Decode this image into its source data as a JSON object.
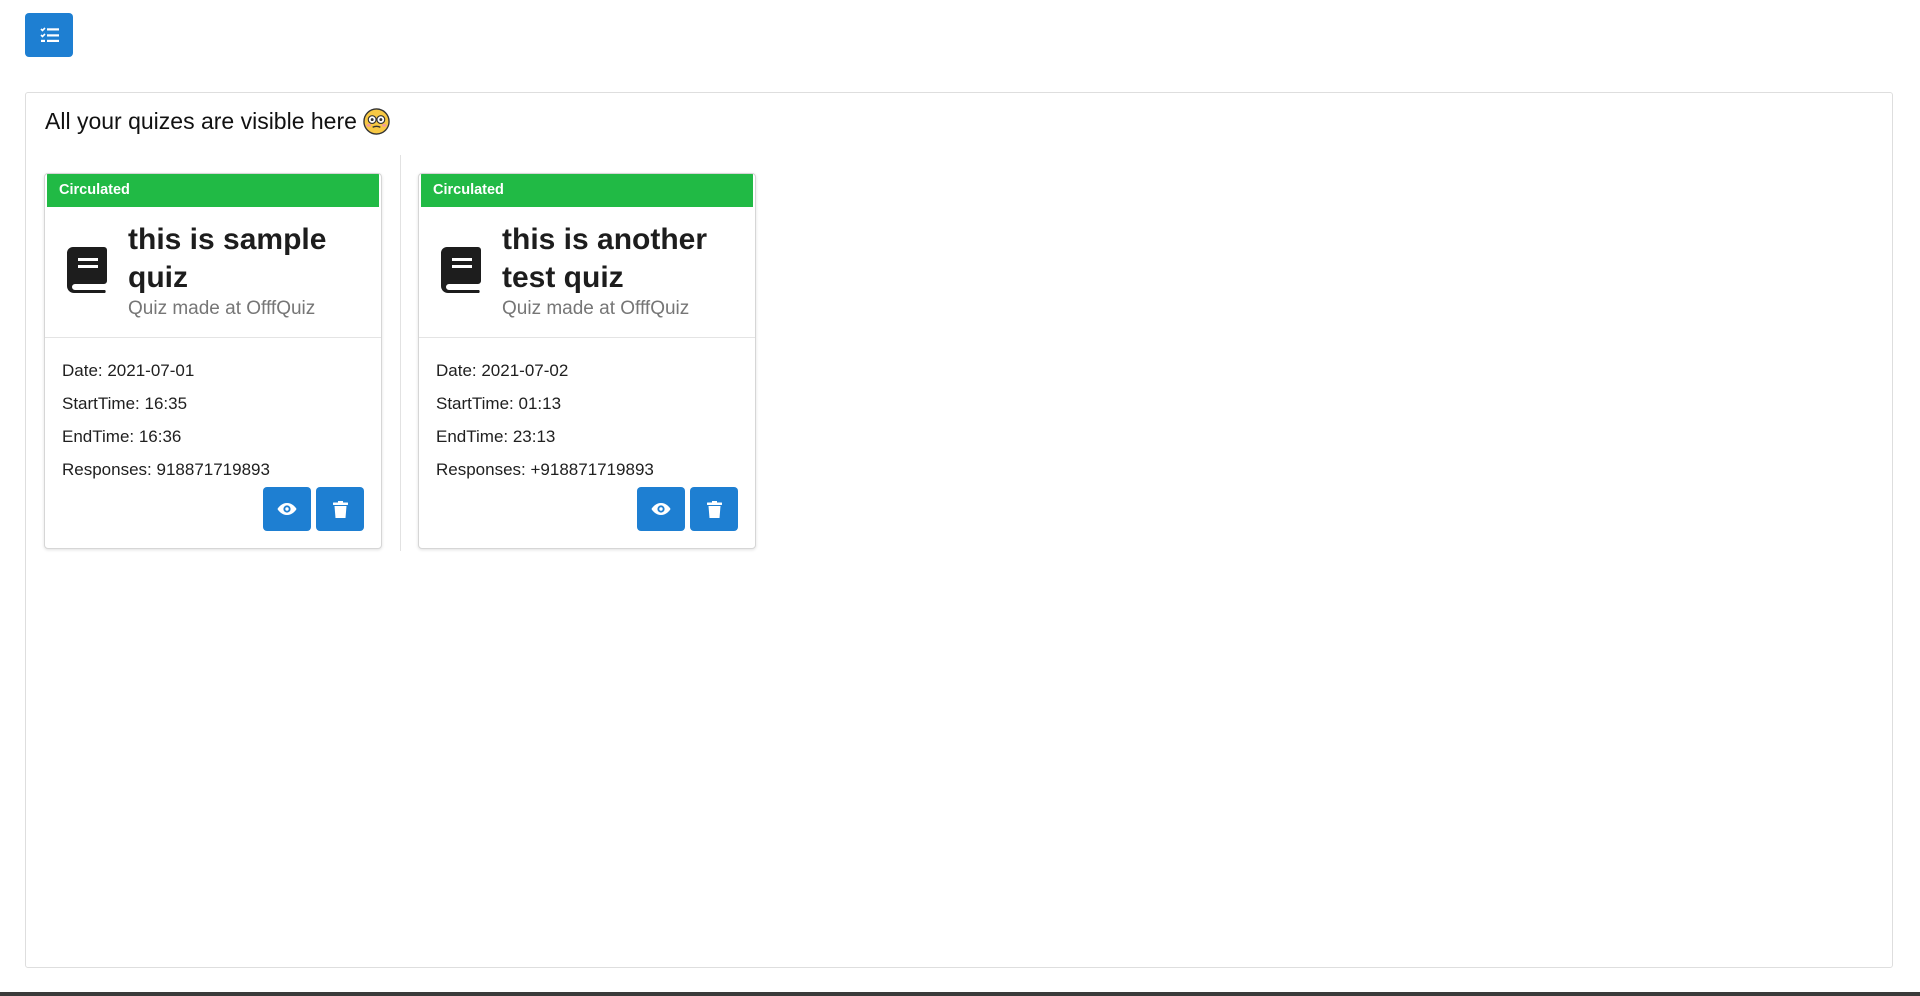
{
  "toolbar": {
    "menu_icon": "list-check-icon",
    "accent": "#1e7fd2"
  },
  "panel": {
    "title": "All your quizes are visible here",
    "title_emoji": "flushed-face-emoji"
  },
  "status_color": "#21ba45",
  "cards": [
    {
      "status": "Circulated",
      "icon": "book-icon",
      "title": "this is sample quiz",
      "subtitle": "Quiz made at OfffQuiz",
      "date": "Date: 2021-07-01",
      "start_time": "StartTime: 16:35",
      "end_time": "EndTime: 16:36",
      "responses": "Responses: 918871719893"
    },
    {
      "status": "Circulated",
      "icon": "book-icon",
      "title": "this is another test quiz",
      "subtitle": "Quiz made at OfffQuiz",
      "date": "Date: 2021-07-02",
      "start_time": "StartTime: 01:13",
      "end_time": "EndTime: 23:13",
      "responses": "Responses: +918871719893"
    }
  ]
}
